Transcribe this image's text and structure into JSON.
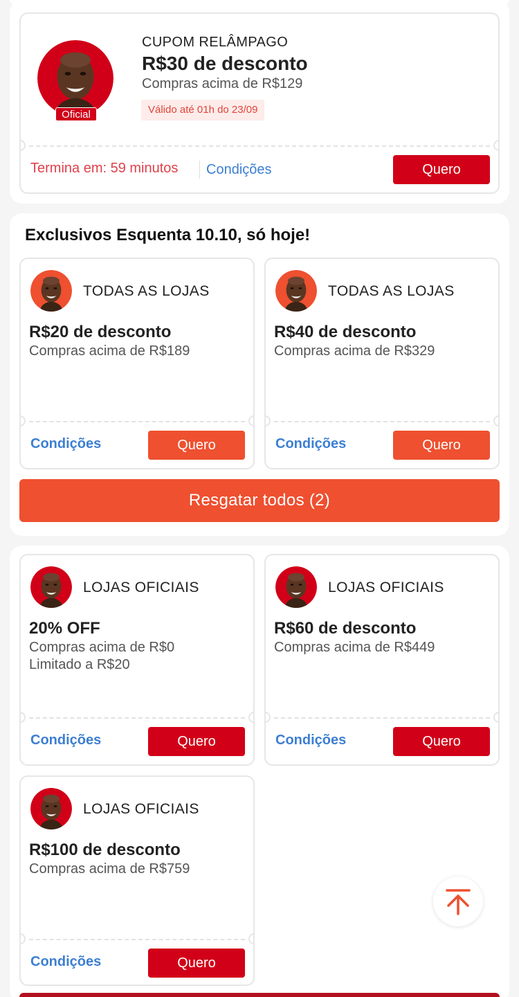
{
  "flash_coupon": {
    "type_label": "CUPOM RELÂMPAGO",
    "title": "R$30 de desconto",
    "min_purchase": "Compras acima de R$129",
    "validity": "Válido até 01h do 23/09",
    "badge": "Oficial",
    "countdown": "Termina em: 59 minutos",
    "conditions_label": "Condições",
    "cta_label": "Quero"
  },
  "exclusive_section": {
    "heading": "Exclusivos Esquenta 10.10, só hoje!",
    "coupons": [
      {
        "scope": "TODAS AS LOJAS",
        "title": "R$20 de desconto",
        "min_purchase": "Compras acima de R$189",
        "conditions_label": "Condições",
        "cta_label": "Quero"
      },
      {
        "scope": "TODAS AS LOJAS",
        "title": "R$40 de desconto",
        "min_purchase": "Compras acima de R$329",
        "conditions_label": "Condições",
        "cta_label": "Quero"
      }
    ],
    "redeem_all_label": "Resgatar todos (2)"
  },
  "official_section": {
    "coupons": [
      {
        "scope": "LOJAS OFICIAIS",
        "title": "20% OFF",
        "min_purchase": "Compras acima de R$0",
        "limit": "Limitado a R$20",
        "conditions_label": "Condições",
        "cta_label": "Quero"
      },
      {
        "scope": "LOJAS OFICIAIS",
        "title": "R$60 de desconto",
        "min_purchase": "Compras acima de R$449",
        "conditions_label": "Condições",
        "cta_label": "Quero"
      },
      {
        "scope": "LOJAS OFICIAIS",
        "title": "R$100 de desconto",
        "min_purchase": "Compras acima de R$759",
        "conditions_label": "Condições",
        "cta_label": "Quero"
      }
    ]
  },
  "icons": {
    "scroll_top": "arrow-up-to-top-icon",
    "avatar": "person-avatar-icon"
  },
  "colors": {
    "brand_red": "#d10018",
    "orange": "#ee5030",
    "link_blue": "#3d7fd1",
    "validity_bg": "#fdecea"
  }
}
